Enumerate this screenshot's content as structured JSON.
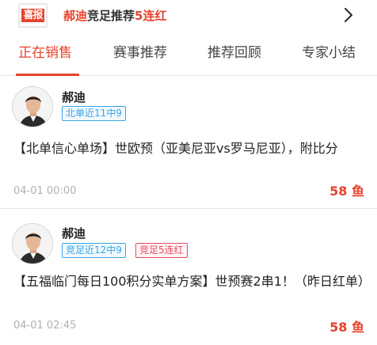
{
  "banner": {
    "badge_text": "喜报",
    "expert_name": "郝迪",
    "middle_text": "竞足推荐",
    "streak_text": "5连红",
    "arrow_icon": "chevron-right-icon"
  },
  "tabs": [
    {
      "label": "正在销售",
      "active": true
    },
    {
      "label": "赛事推荐",
      "active": false
    },
    {
      "label": "推荐回顾",
      "active": false
    },
    {
      "label": "专家小结",
      "active": false
    }
  ],
  "colors": {
    "accent": "#e8412c",
    "tag_blue": "#3aa3e3",
    "tag_red": "#e84a5f",
    "muted": "#b0b0b0"
  },
  "cards": [
    {
      "expert_name": "郝迪",
      "tags": [
        {
          "text": "北单近11中9",
          "style": "blue"
        }
      ],
      "title": "【北单信心单场】世欧预（亚美尼亚vs罗马尼亚），附比分",
      "time": "04-01 00:00",
      "price": "58 鱼"
    },
    {
      "expert_name": "郝迪",
      "tags": [
        {
          "text": "竞足近12中9",
          "style": "blue"
        },
        {
          "text": "竞足5连红",
          "style": "red"
        }
      ],
      "title": "【五福临门每日100积分实单方案】世预赛2串1！（昨日红单）",
      "time": "04-01 02:45",
      "price": "58 鱼"
    }
  ]
}
